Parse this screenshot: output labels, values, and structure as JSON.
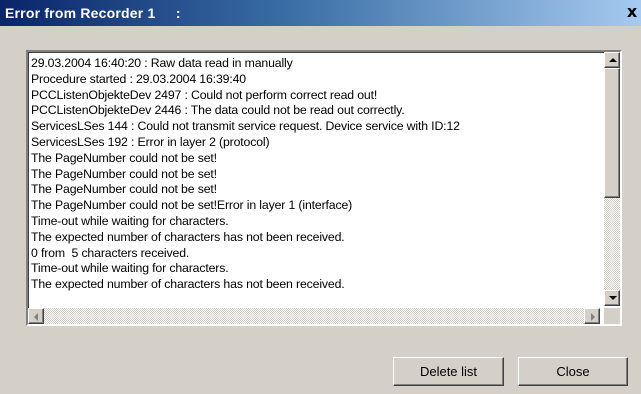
{
  "window": {
    "title": "Error from Recorder 1     :",
    "close_glyph": "x"
  },
  "log": {
    "lines": [
      "29.03.2004 16:40:20 : Raw data read in manually",
      "Procedure started : 29.03.2004 16:39:40",
      "PCCListenObjekteDev 2497 : Could not perform correct read out!",
      "PCCListenObjekteDev 2446 : The data could not be read out correctly.",
      "ServicesLSes 144 : Could not transmit service request. Device service with ID:12",
      "ServicesLSes 192 : Error in layer 2 (protocol)",
      "The PageNumber could not be set!",
      "The PageNumber could not be set!",
      "The PageNumber could not be set!",
      "The PageNumber could not be set!Error in layer 1 (interface)",
      "Time-out while waiting for characters.",
      "The expected number of characters has not been received.",
      "0 from  5 characters received.",
      "Time-out while waiting for characters.",
      "The expected number of characters has not been received."
    ]
  },
  "buttons": {
    "delete_label": "Delete list",
    "close_label": "Close"
  },
  "colors": {
    "titlebar_start": "#0a246a",
    "titlebar_end": "#a6caf0",
    "dialog_face": "#d4d0c8"
  }
}
